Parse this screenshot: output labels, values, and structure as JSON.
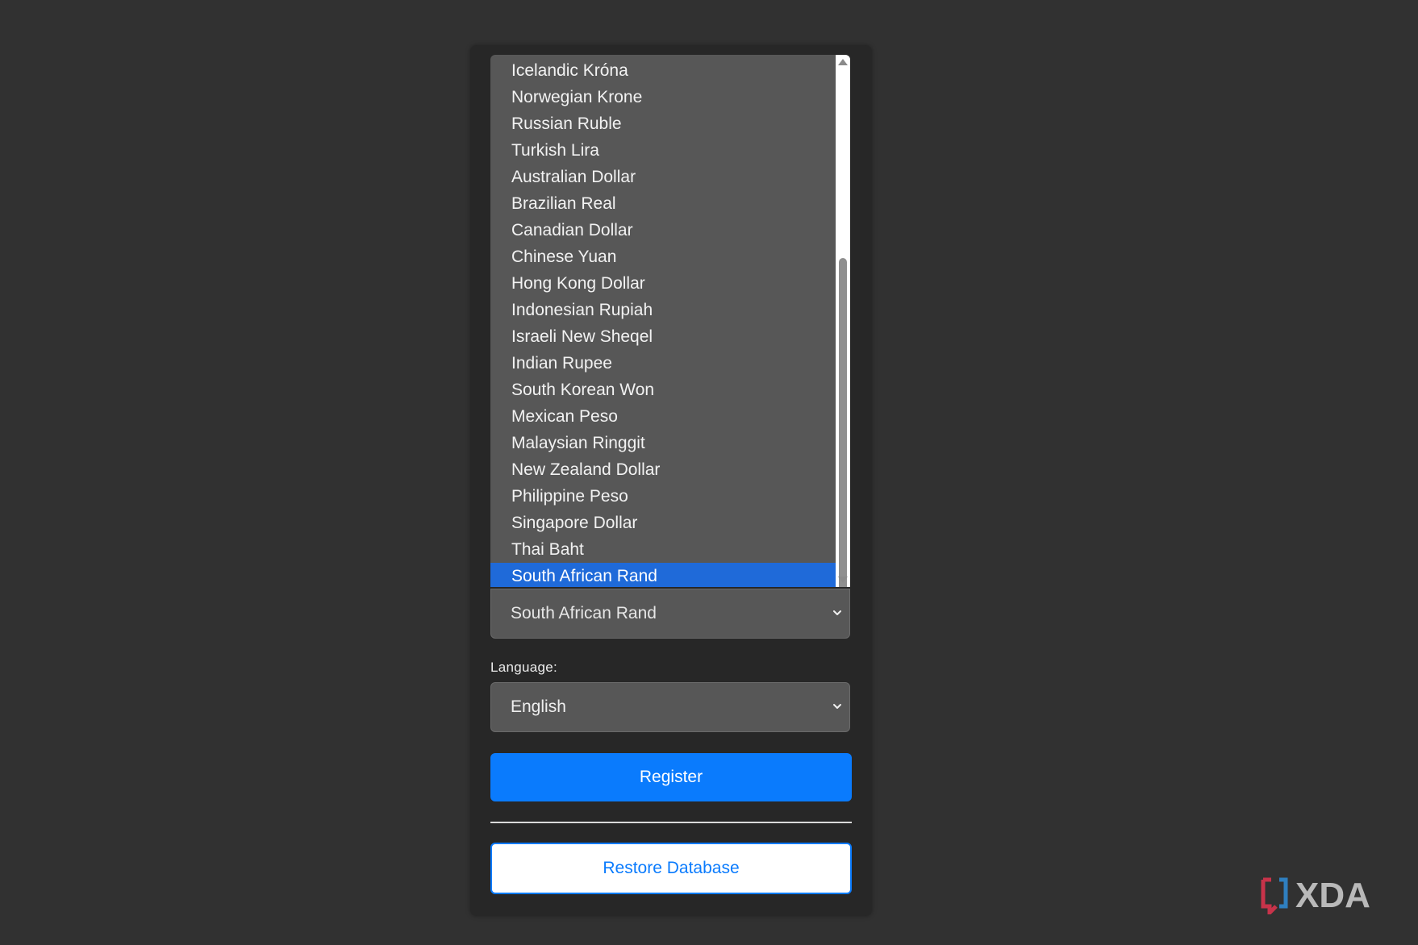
{
  "currency_dropdown": {
    "options": [
      "Icelandic Króna",
      "Norwegian Krone",
      "Russian Ruble",
      "Turkish Lira",
      "Australian Dollar",
      "Brazilian Real",
      "Canadian Dollar",
      "Chinese Yuan",
      "Hong Kong Dollar",
      "Indonesian Rupiah",
      "Israeli New Sheqel",
      "Indian Rupee",
      "South Korean Won",
      "Mexican Peso",
      "Malaysian Ringgit",
      "New Zealand Dollar",
      "Philippine Peso",
      "Singapore Dollar",
      "Thai Baht",
      "South African Rand"
    ],
    "highlighted_option": "South African Rand",
    "selected_value": "South African Rand"
  },
  "language": {
    "label": "Language:",
    "selected_value": "English"
  },
  "register_button": {
    "label": "Register"
  },
  "restore_button": {
    "label": "Restore Database"
  },
  "watermark": {
    "brand": "XDA"
  },
  "colors": {
    "page_background": "#313131",
    "card_background": "#272727",
    "field_background": "#575757",
    "highlight": "#1f6ad9",
    "primary": "#0a7bfd",
    "watermark_red": "#c8334a",
    "watermark_blue": "#2f7fbf"
  },
  "icons": {
    "select_chevron": "chevron-down-icon",
    "scroll_up": "scroll-up-arrow-icon",
    "scroll_down": "scroll-down-arrow-icon",
    "brand": "xda-logo"
  }
}
